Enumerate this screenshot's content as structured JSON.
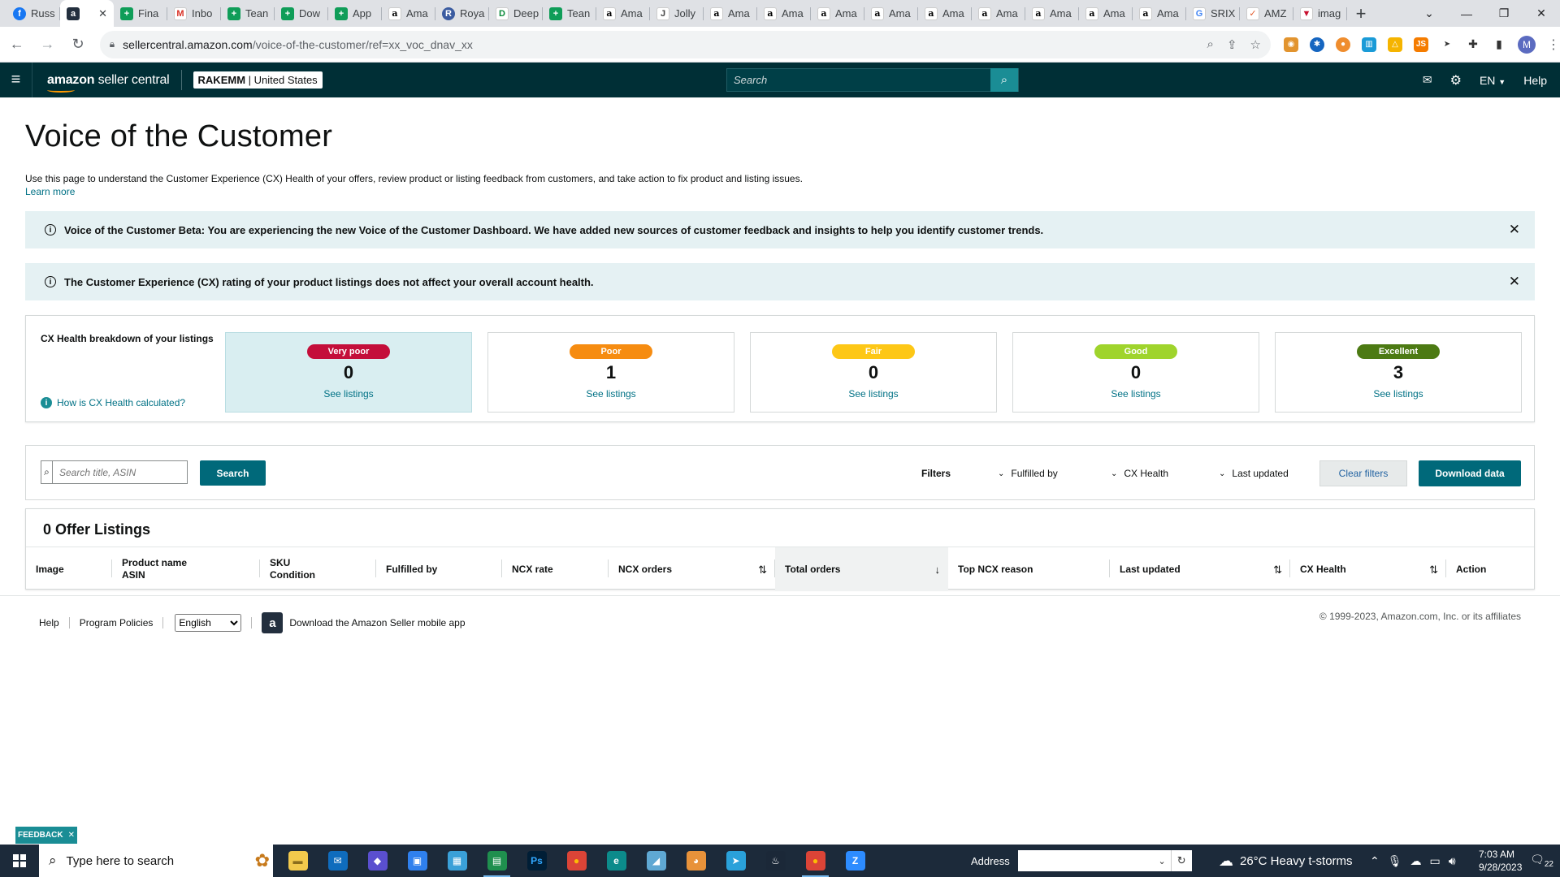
{
  "browser": {
    "tabs": [
      {
        "label": "Russ",
        "favicon": "facebook-icon",
        "glyph": "f",
        "cls": "fav-fb"
      },
      {
        "label": "",
        "favicon": "amazon-seller-icon",
        "glyph": "a",
        "cls": "fav-amzd",
        "active": true
      },
      {
        "label": "Fina",
        "favicon": "sheets-icon",
        "glyph": "+",
        "cls": "fav-sheet"
      },
      {
        "label": "Inbo",
        "favicon": "gmail-icon",
        "glyph": "M",
        "cls": "fav-gm"
      },
      {
        "label": "Tean",
        "favicon": "sheets-icon",
        "glyph": "+",
        "cls": "fav-sheet"
      },
      {
        "label": "Dow",
        "favicon": "sheets-icon",
        "glyph": "+",
        "cls": "fav-sheet"
      },
      {
        "label": "App",
        "favicon": "sheets-icon",
        "glyph": "+",
        "cls": "fav-sheet"
      },
      {
        "label": "Ama",
        "favicon": "amazon-icon",
        "glyph": "a",
        "cls": "fav-amz"
      },
      {
        "label": "Roya",
        "favicon": "royalty-icon",
        "glyph": "R",
        "cls": "fav-roy"
      },
      {
        "label": "Deep",
        "favicon": "deepl-icon",
        "glyph": "D",
        "cls": "fav-deep"
      },
      {
        "label": "Tean",
        "favicon": "sheets-icon",
        "glyph": "+",
        "cls": "fav-sheet"
      },
      {
        "label": "Ama",
        "favicon": "amazon-icon",
        "glyph": "a",
        "cls": "fav-amz"
      },
      {
        "label": "Jolly",
        "favicon": "jolly-icon",
        "glyph": "J",
        "cls": "fav-jolly"
      },
      {
        "label": "Ama",
        "favicon": "amazon-icon",
        "glyph": "a",
        "cls": "fav-amz"
      },
      {
        "label": "Ama",
        "favicon": "amazon-icon",
        "glyph": "a",
        "cls": "fav-amz"
      },
      {
        "label": "Ama",
        "favicon": "amazon-icon",
        "glyph": "a",
        "cls": "fav-amz"
      },
      {
        "label": "Ama",
        "favicon": "amazon-icon",
        "glyph": "a",
        "cls": "fav-amz"
      },
      {
        "label": "Ama",
        "favicon": "amazon-icon",
        "glyph": "a",
        "cls": "fav-amz"
      },
      {
        "label": "Ama",
        "favicon": "amazon-icon",
        "glyph": "a",
        "cls": "fav-amz"
      },
      {
        "label": "Ama",
        "favicon": "amazon-icon",
        "glyph": "a",
        "cls": "fav-amz"
      },
      {
        "label": "Ama",
        "favicon": "amazon-icon",
        "glyph": "a",
        "cls": "fav-amz"
      },
      {
        "label": "Ama",
        "favicon": "amazon-icon",
        "glyph": "a",
        "cls": "fav-amz"
      },
      {
        "label": "SRIX",
        "favicon": "google-icon",
        "glyph": "G",
        "cls": "fav-g"
      },
      {
        "label": "AMZ",
        "favicon": "amz-tool-icon",
        "glyph": "✓",
        "cls": "fav-amzx"
      },
      {
        "label": "imag",
        "favicon": "image-icon",
        "glyph": "▼",
        "cls": "fav-img"
      }
    ],
    "url_host": "sellercentral.amazon.com",
    "url_path": "/voice-of-the-customer/ref=xx_voc_dnav_xx",
    "profile_initial": "M"
  },
  "header": {
    "brand_amazon": "amazon",
    "brand_sc": " seller central",
    "account": "RAKEMM",
    "marketplace": " | United States",
    "search_placeholder": "Search",
    "language": "EN",
    "help": "Help"
  },
  "page": {
    "title": "Voice of the Customer",
    "intro": "Use this page to understand the Customer Experience (CX) Health of your offers, review product or listing feedback from customers, and take action to fix product and listing issues.",
    "learn_more": "Learn more",
    "banner_beta": "Voice of the Customer Beta: You are experiencing the new Voice of the Customer Dashboard. We have added new sources of customer feedback and insights to help you identify customer trends.",
    "banner_rating": "The Customer Experience (CX) rating of your product listings does not affect your overall account health."
  },
  "health": {
    "label": "CX Health breakdown of your listings",
    "help_link": "How is CX Health calculated?",
    "cards": [
      {
        "label": "Very poor",
        "count": "0",
        "link": "See listings",
        "color": "#c40e3a",
        "selected": true
      },
      {
        "label": "Poor",
        "count": "1",
        "link": "See listings",
        "color": "#f68c11",
        "selected": false
      },
      {
        "label": "Fair",
        "count": "0",
        "link": "See listings",
        "color": "#fdc716",
        "selected": false
      },
      {
        "label": "Good",
        "count": "0",
        "link": "See listings",
        "color": "#9fd42c",
        "selected": false
      },
      {
        "label": "Excellent",
        "count": "3",
        "link": "See listings",
        "color": "#4c7a13",
        "selected": false
      }
    ]
  },
  "filters": {
    "search_placeholder": "Search title, ASIN",
    "search_button": "Search",
    "filters_label": "Filters",
    "fulfilled_by": "Fulfilled by",
    "cx_health": "CX Health",
    "last_updated": "Last updated",
    "clear": "Clear filters",
    "download": "Download data"
  },
  "listings": {
    "heading": "0 Offer Listings",
    "columns": [
      {
        "l1": "Image",
        "l2": ""
      },
      {
        "l1": "Product name",
        "l2": "ASIN"
      },
      {
        "l1": "SKU",
        "l2": "Condition"
      },
      {
        "l1": "Fulfilled by",
        "l2": ""
      },
      {
        "l1": "NCX rate",
        "l2": ""
      },
      {
        "l1": "NCX orders",
        "l2": "",
        "sort": "⇅"
      },
      {
        "l1": "Total orders",
        "l2": "",
        "sort": "↓",
        "sorted": true
      },
      {
        "l1": "Top NCX reason",
        "l2": ""
      },
      {
        "l1": "Last updated",
        "l2": "",
        "sort": "⇅"
      },
      {
        "l1": "CX Health",
        "l2": "",
        "sort": "⇅"
      },
      {
        "l1": "Action",
        "l2": ""
      }
    ]
  },
  "footer": {
    "help": "Help",
    "policies": "Program Policies",
    "language": "English",
    "app_download": "Download the Amazon Seller mobile app",
    "copyright": "© 1999-2023, Amazon.com, Inc. or its affiliates"
  },
  "feedback": "FEEDBACK",
  "taskbar": {
    "search_placeholder": "Type here to search",
    "address_label": "Address",
    "weather": "26°C  Heavy t-storms",
    "time": "7:03 AM",
    "date": "9/28/2023",
    "notif_count": "22",
    "apps": [
      {
        "name": "file-explorer-icon",
        "glyph": "▬",
        "bg": "#f2c94c",
        "fg": "#8a6d1c",
        "running": false
      },
      {
        "name": "mail-icon",
        "glyph": "✉",
        "bg": "#0f6cbd",
        "fg": "#fff",
        "running": false
      },
      {
        "name": "cube-app-icon",
        "glyph": "◆",
        "bg": "#5a4fcf",
        "fg": "#fff",
        "running": false
      },
      {
        "name": "store-icon",
        "glyph": "▣",
        "bg": "#2f80ed",
        "fg": "#fff",
        "running": false
      },
      {
        "name": "calculator-icon",
        "glyph": "▦",
        "bg": "#3aa0d8",
        "fg": "#fff",
        "running": false
      },
      {
        "name": "sheets-app-icon",
        "glyph": "▤",
        "bg": "#1f8f4e",
        "fg": "#fff",
        "running": true
      },
      {
        "name": "photoshop-icon",
        "glyph": "Ps",
        "bg": "#001e36",
        "fg": "#31a8ff",
        "running": false
      },
      {
        "name": "chrome-icon",
        "glyph": "●",
        "bg": "#db4437",
        "fg": "#fbbc05",
        "running": false
      },
      {
        "name": "edge-icon",
        "glyph": "e",
        "bg": "#0c8b8b",
        "fg": "#fff",
        "running": false
      },
      {
        "name": "paint-icon",
        "glyph": "◢",
        "bg": "#5fa8d3",
        "fg": "#fff",
        "running": false
      },
      {
        "name": "game-icon",
        "glyph": "◕",
        "bg": "#e8923a",
        "fg": "#fff",
        "running": false
      },
      {
        "name": "telegram-icon",
        "glyph": "➤",
        "bg": "#2aa1da",
        "fg": "#fff",
        "running": false
      },
      {
        "name": "steam-icon",
        "glyph": "♨",
        "bg": "#1b2838",
        "fg": "#fff",
        "running": false
      },
      {
        "name": "chrome-profile-icon",
        "glyph": "●",
        "bg": "#db4437",
        "fg": "#fbbc05",
        "running": true
      },
      {
        "name": "zoom-icon",
        "glyph": "Z",
        "bg": "#2d8cff",
        "fg": "#fff",
        "running": false
      }
    ]
  }
}
